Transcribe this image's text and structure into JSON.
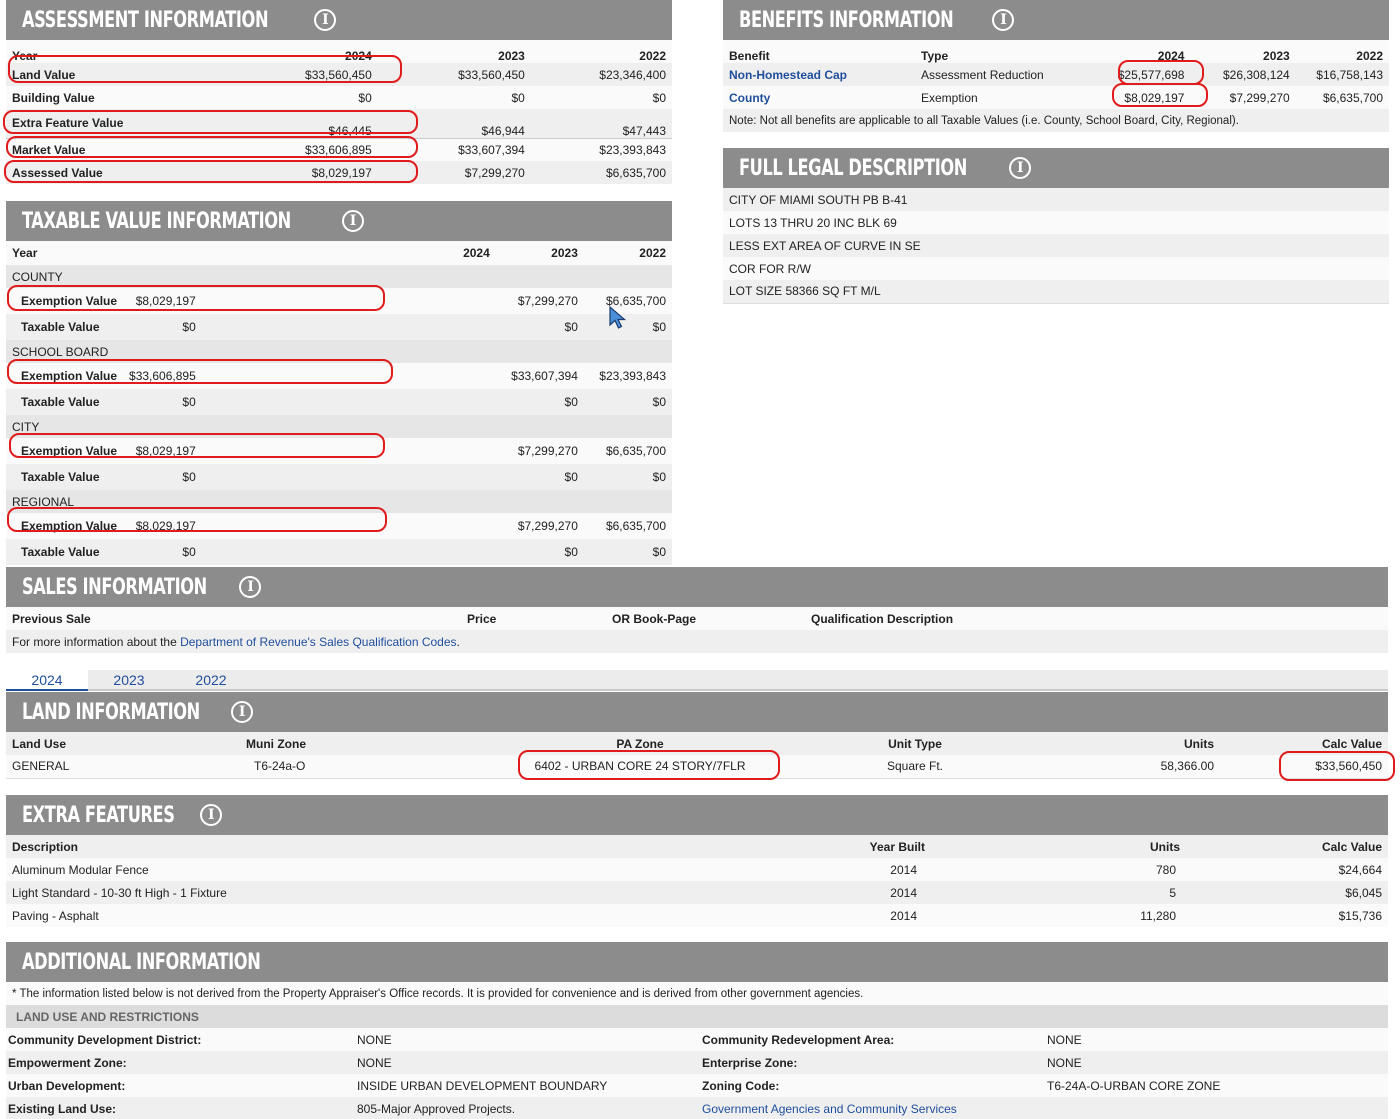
{
  "assessment": {
    "title": "ASSESSMENT INFORMATION",
    "headers": [
      "Year",
      "2024",
      "2023",
      "2022"
    ],
    "rows": [
      {
        "label": "Land Value",
        "v": [
          "$33,560,450",
          "$33,560,450",
          "$23,346,400"
        ]
      },
      {
        "label": "Building Value",
        "v": [
          "$0",
          "$0",
          "$0"
        ]
      },
      {
        "label": "Extra Feature Value",
        "v": [
          "$46,445",
          "$46,944",
          "$47,443"
        ]
      },
      {
        "label": "Market Value",
        "v": [
          "$33,606,895",
          "$33,607,394",
          "$23,393,843"
        ]
      },
      {
        "label": "Assessed Value",
        "v": [
          "$8,029,197",
          "$7,299,270",
          "$6,635,700"
        ]
      }
    ]
  },
  "taxable": {
    "title": "TAXABLE VALUE INFORMATION",
    "headers": [
      "Year",
      "2024",
      "2023",
      "2022"
    ],
    "groups": [
      {
        "name": "COUNTY",
        "exemption": [
          "$8,029,197",
          "$7,299,270",
          "$6,635,700"
        ],
        "taxable": [
          "$0",
          "$0",
          "$0"
        ]
      },
      {
        "name": "SCHOOL BOARD",
        "exemption": [
          "$33,606,895",
          "$33,607,394",
          "$23,393,843"
        ],
        "taxable": [
          "$0",
          "$0",
          "$0"
        ]
      },
      {
        "name": "CITY",
        "exemption": [
          "$8,029,197",
          "$7,299,270",
          "$6,635,700"
        ],
        "taxable": [
          "$0",
          "$0",
          "$0"
        ]
      },
      {
        "name": "REGIONAL",
        "exemption": [
          "$8,029,197",
          "$7,299,270",
          "$6,635,700"
        ],
        "taxable": [
          "$0",
          "$0",
          "$0"
        ]
      }
    ],
    "exemption_label": "Exemption Value",
    "taxable_label": "Taxable Value"
  },
  "benefits": {
    "title": "BENEFITS INFORMATION",
    "headers": [
      "Benefit",
      "Type",
      "2024",
      "2023",
      "2022"
    ],
    "rows": [
      {
        "benefit": "Non-Homestead Cap",
        "type": "Assessment Reduction",
        "v": [
          "$25,577,698",
          "$26,308,124",
          "$16,758,143"
        ]
      },
      {
        "benefit": "County",
        "type": "Exemption",
        "v": [
          "$8,029,197",
          "$7,299,270",
          "$6,635,700"
        ]
      }
    ],
    "note": "Note: Not all benefits are applicable to all Taxable Values (i.e. County, School Board, City, Regional)."
  },
  "legal": {
    "title": "FULL LEGAL DESCRIPTION",
    "lines": [
      "CITY OF MIAMI SOUTH PB B-41",
      "LOTS 13 THRU 20 INC BLK 69",
      "LESS EXT AREA OF CURVE IN SE",
      "COR FOR R/W",
      "LOT SIZE 58366 SQ FT M/L"
    ]
  },
  "sales": {
    "title": "SALES INFORMATION",
    "headers": [
      "Previous Sale",
      "Price",
      "OR Book-Page",
      "Qualification Description"
    ],
    "info_prefix": "For more information about the ",
    "info_link": "Department of Revenue's Sales Qualification Codes",
    "info_suffix": "."
  },
  "year_tabs": [
    "2024",
    "2023",
    "2022"
  ],
  "land": {
    "title": "LAND INFORMATION",
    "headers": [
      "Land Use",
      "Muni Zone",
      "PA Zone",
      "Unit Type",
      "Units",
      "Calc Value"
    ],
    "row": [
      "GENERAL",
      "T6-24a-O",
      "6402 - URBAN CORE 24 STORY/7FLR",
      "Square Ft.",
      "58,366.00",
      "$33,560,450"
    ]
  },
  "extra": {
    "title": "EXTRA FEATURES",
    "headers": [
      "Description",
      "Year Built",
      "Units",
      "Calc Value"
    ],
    "rows": [
      [
        "Aluminum Modular Fence",
        "2014",
        "780",
        "$24,664"
      ],
      [
        "Light Standard - 10-30 ft High - 1 Fixture",
        "2014",
        "5",
        "$6,045"
      ],
      [
        "Paving - Asphalt",
        "2014",
        "11,280",
        "$15,736"
      ]
    ]
  },
  "additional": {
    "title": "ADDITIONAL INFORMATION",
    "note": "* The information listed below is not derived from the Property Appraiser's Office records. It is provided for convenience and is derived from other government agencies.",
    "subheader": "LAND USE AND RESTRICTIONS",
    "rows": [
      {
        "l1": "Community Development District:",
        "v1": "NONE",
        "l2": "Community Redevelopment Area:",
        "v2": "NONE"
      },
      {
        "l1": "Empowerment Zone:",
        "v1": "NONE",
        "l2": "Enterprise Zone:",
        "v2": "NONE"
      },
      {
        "l1": "Urban Development:",
        "v1": "INSIDE URBAN DEVELOPMENT BOUNDARY",
        "l2": "Zoning Code:",
        "v2": "T6-24A-O-URBAN CORE ZONE"
      },
      {
        "l1": "Existing Land Use:",
        "v1": "805-Major Approved Projects.",
        "l2": "Government Agencies and Community Services",
        "v2": ""
      }
    ]
  },
  "colors": {
    "header_bg": "#8c8c8c",
    "highlight": "#e01b1b",
    "link": "#1f4e9c"
  }
}
